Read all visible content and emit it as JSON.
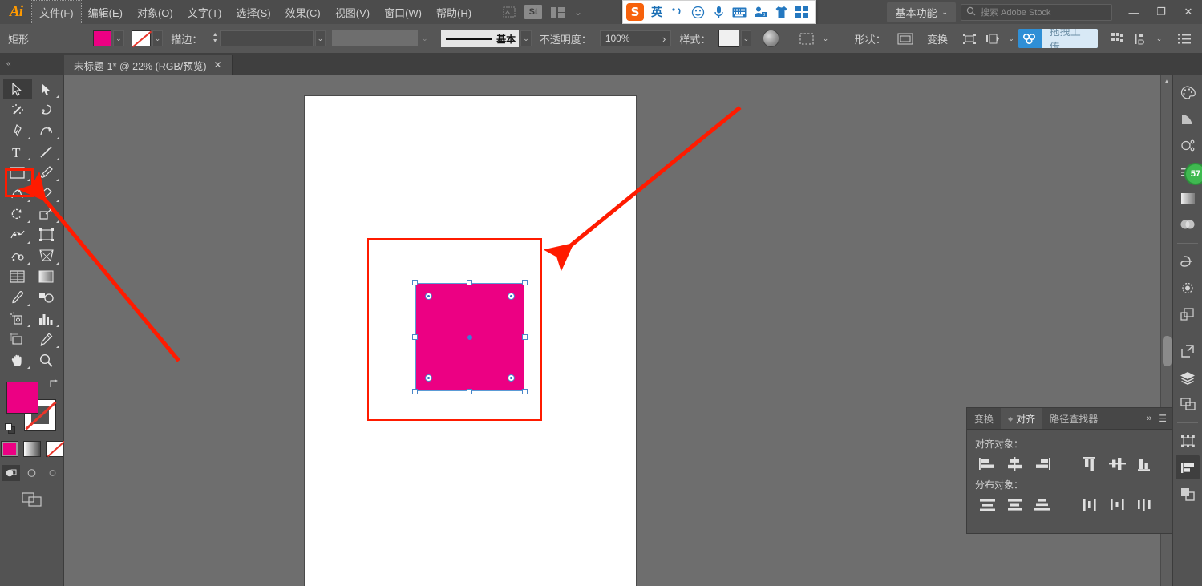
{
  "app": {
    "name": "Ai",
    "logo_color": "#ff9a00"
  },
  "menubar": {
    "items": [
      {
        "label": "文件(F)",
        "focused": true
      },
      {
        "label": "编辑(E)",
        "focused": false
      },
      {
        "label": "对象(O)",
        "focused": false
      },
      {
        "label": "文字(T)",
        "focused": false
      },
      {
        "label": "选择(S)",
        "focused": false
      },
      {
        "label": "效果(C)",
        "focused": false
      },
      {
        "label": "视图(V)",
        "focused": false
      },
      {
        "label": "窗口(W)",
        "focused": false
      },
      {
        "label": "帮助(H)",
        "focused": false
      }
    ],
    "bridge_icon": "bridge-icon",
    "stock_icon": "St",
    "arrange_icon": "arrange-documents-icon",
    "workspace": "基本功能",
    "search_placeholder": "搜索 Adobe Stock",
    "search_icon": "search-icon",
    "window_minimize": "—",
    "window_restore": "❐",
    "window_close": "✕"
  },
  "ime": {
    "logo": "S",
    "mode": "英",
    "comma_icon": "punctuation-icon",
    "emoji_icon": "☺",
    "mic_icon": "microphone-icon",
    "keyboard_icon": "keyboard-icon",
    "user_icon": "user-icon",
    "skin_icon": "skin-icon",
    "toolbox_icon": "toolbox-icon"
  },
  "controlbar": {
    "tool_name": "矩形",
    "fill_color": "#ec0083",
    "fill_caret": "⌄",
    "stroke_swatch": "none",
    "stroke_caret": "⌄",
    "stroke_label": "描边：",
    "stroke_weight_value": "",
    "stroke_weight_caret": "⌄",
    "stroke_profile_value": "",
    "stroke_profile_caret": "⌄",
    "brush_def_label": "基本",
    "brush_caret": "⌄",
    "opacity_label": "不透明度：",
    "opacity_value": "100%",
    "opacity_arrow": "›",
    "style_label": "样式：",
    "style_caret": "⌄",
    "recolor_icon": "recolor-artwork-icon",
    "select_similar_icon": "select-similar-icon",
    "select_similar_caret": "⌄",
    "shape_label": "形状：",
    "shape_icon": "shape-icon",
    "transform_label": "变换",
    "align_icon": "align-icon",
    "arrange_icon": "arrange-icon",
    "arrange_caret": "⌄",
    "upload_label": "拖拽上传",
    "upload_icon": "cloud-upload-icon",
    "grid_icon": "grid-icon",
    "distribute_icon": "distribute-icon",
    "distribute_caret": "⌄",
    "menu_icon": "panel-menu-icon"
  },
  "tabbar": {
    "collapse_icon": "«",
    "document_title": "未标题-1* @ 22% (RGB/预览)",
    "close_icon": "✕"
  },
  "toolbar": {
    "rows": [
      [
        {
          "name": "selection-tool",
          "label": "选择工具",
          "selected": true,
          "has_corner": false
        },
        {
          "name": "direct-selection-tool",
          "label": "直接选择工具",
          "selected": false,
          "has_corner": true
        }
      ],
      [
        {
          "name": "magic-wand-tool",
          "label": "魔棒工具",
          "selected": false,
          "has_corner": false
        },
        {
          "name": "lasso-tool",
          "label": "套索工具",
          "selected": false,
          "has_corner": false
        }
      ],
      [
        {
          "name": "pen-tool",
          "label": "钢笔工具",
          "selected": false,
          "has_corner": true
        },
        {
          "name": "curvature-tool",
          "label": "曲率工具",
          "selected": false,
          "has_corner": true
        }
      ],
      [
        {
          "name": "type-tool",
          "label": "文字工具",
          "selected": false,
          "has_corner": true
        },
        {
          "name": "line-segment-tool",
          "label": "直线段工具",
          "selected": false,
          "has_corner": true
        }
      ],
      [
        {
          "name": "rectangle-tool",
          "label": "矩形工具",
          "selected": false,
          "has_corner": true
        },
        {
          "name": "paintbrush-tool",
          "label": "画笔工具",
          "selected": false,
          "has_corner": true
        }
      ],
      [
        {
          "name": "shaper-tool",
          "label": "Shaper 工具",
          "selected": false,
          "has_corner": true
        },
        {
          "name": "eraser-tool",
          "label": "橡皮擦工具",
          "selected": false,
          "has_corner": true
        }
      ],
      [
        {
          "name": "rotate-tool",
          "label": "旋转工具",
          "selected": false,
          "has_corner": true
        },
        {
          "name": "scale-tool",
          "label": "比例缩放工具",
          "selected": false,
          "has_corner": true
        }
      ],
      [
        {
          "name": "width-tool",
          "label": "宽度工具",
          "selected": false,
          "has_corner": true
        },
        {
          "name": "free-transform-tool",
          "label": "自由变换工具",
          "selected": false,
          "has_corner": false
        }
      ],
      [
        {
          "name": "shape-builder-tool",
          "label": "形状生成器工具",
          "selected": false,
          "has_corner": true
        },
        {
          "name": "perspective-grid-tool",
          "label": "透视网格工具",
          "selected": false,
          "has_corner": true
        }
      ],
      [
        {
          "name": "mesh-tool",
          "label": "网格工具",
          "selected": false,
          "has_corner": false
        },
        {
          "name": "gradient-tool",
          "label": "渐变工具",
          "selected": false,
          "has_corner": false
        }
      ],
      [
        {
          "name": "eyedropper-tool",
          "label": "吸管工具",
          "selected": false,
          "has_corner": true
        },
        {
          "name": "blend-tool",
          "label": "混合工具",
          "selected": false,
          "has_corner": false
        }
      ],
      [
        {
          "name": "symbol-sprayer-tool",
          "label": "符号喷枪工具",
          "selected": false,
          "has_corner": true
        },
        {
          "name": "column-graph-tool",
          "label": "柱形图工具",
          "selected": false,
          "has_corner": true
        }
      ],
      [
        {
          "name": "artboard-tool",
          "label": "画板工具",
          "selected": false,
          "has_corner": false
        },
        {
          "name": "slice-tool",
          "label": "切片工具",
          "selected": false,
          "has_corner": true
        }
      ],
      [
        {
          "name": "hand-tool",
          "label": "抓手工具",
          "selected": false,
          "has_corner": true
        },
        {
          "name": "zoom-tool",
          "label": "缩放工具",
          "selected": false,
          "has_corner": false
        }
      ]
    ],
    "fill_color": "#ec0083",
    "stroke_color": "none",
    "swap_icon": "swap-fill-stroke-icon",
    "default_icon": "default-fill-stroke-icon",
    "modes": [
      {
        "name": "color-mode",
        "label": "颜色",
        "active": true
      },
      {
        "name": "gradient-mode",
        "label": "渐变",
        "active": false
      },
      {
        "name": "none-mode",
        "label": "无",
        "active": false
      }
    ],
    "draw_modes": [
      {
        "name": "draw-normal-mode",
        "label": "正常绘图",
        "active": true
      },
      {
        "name": "draw-behind-mode",
        "label": "背面绘图",
        "active": false
      },
      {
        "name": "draw-inside-mode",
        "label": "内部绘图",
        "active": false
      }
    ],
    "screen_mode": "change-screen-mode-icon"
  },
  "canvas": {
    "background": "#6e6e6e",
    "artboard_color": "#ffffff",
    "shape": {
      "name": "rectangle",
      "fill": "#ec0083",
      "selection_color": "#5b9bd5"
    },
    "annotation_color": "#ff1b00",
    "scrollbar": {
      "up_arrow": "▲"
    }
  },
  "right_dock": {
    "icons": [
      {
        "name": "color-panel-icon",
        "label": "颜色",
        "badge": null,
        "active": false
      },
      {
        "name": "color-guide-panel-icon",
        "label": "颜色参考",
        "badge": null,
        "active": false
      },
      {
        "name": "symbols-panel-icon",
        "label": "符号",
        "badge": null,
        "active": false
      },
      {
        "name": "stroke-panel-icon",
        "label": "描边",
        "badge": "57",
        "active": false
      },
      {
        "name": "gradient-panel-icon",
        "label": "渐变",
        "badge": null,
        "active": false
      },
      {
        "name": "transparency-panel-icon",
        "label": "透明度",
        "badge": null,
        "active": false
      },
      {
        "name": "creative-cloud-libraries-icon",
        "label": "CC 库",
        "badge": null,
        "active": false
      },
      {
        "name": "brushes-panel-icon",
        "label": "画笔",
        "badge": null,
        "active": false
      },
      {
        "name": "appearance-panel-icon",
        "label": "外观",
        "badge": null,
        "active": false
      },
      {
        "name": "asset-export-panel-icon",
        "label": "资源导出",
        "badge": null,
        "active": false
      },
      {
        "name": "layers-panel-icon",
        "label": "图层",
        "badge": null,
        "active": false
      },
      {
        "name": "artboards-panel-icon",
        "label": "画板",
        "badge": null,
        "active": false
      },
      {
        "name": "transform-panel-icon",
        "label": "变换",
        "badge": null,
        "active": false
      },
      {
        "name": "align-panel-icon",
        "label": "对齐",
        "badge": null,
        "active": true
      },
      {
        "name": "pathfinder-panel-icon",
        "label": "路径查找器",
        "badge": null,
        "active": false
      }
    ]
  },
  "align_panel": {
    "tabs": [
      {
        "label": "变换",
        "active": false
      },
      {
        "label": "对齐",
        "active": true
      },
      {
        "label": "路径查找器",
        "active": false
      }
    ],
    "collapse_icon": "»",
    "menu_icon": "☰",
    "align_section": "对齐对象：",
    "align_buttons": [
      {
        "name": "align-left-icon",
        "label": "水平左对齐"
      },
      {
        "name": "align-horizontal-center-icon",
        "label": "水平居中对齐"
      },
      {
        "name": "align-right-icon",
        "label": "水平右对齐"
      },
      {
        "name": "align-top-icon",
        "label": "垂直顶对齐"
      },
      {
        "name": "align-vertical-center-icon",
        "label": "垂直居中对齐"
      },
      {
        "name": "align-bottom-icon",
        "label": "垂直底对齐"
      }
    ],
    "distribute_section": "分布对象：",
    "distribute_buttons": [
      {
        "name": "distribute-top-icon",
        "label": "垂直顶分布"
      },
      {
        "name": "distribute-vertical-center-icon",
        "label": "垂直居中分布"
      },
      {
        "name": "distribute-bottom-icon",
        "label": "垂直底分布"
      },
      {
        "name": "distribute-left-icon",
        "label": "水平左分布"
      },
      {
        "name": "distribute-horizontal-center-icon",
        "label": "水平居中分布"
      },
      {
        "name": "distribute-right-icon",
        "label": "水平右分布"
      }
    ]
  }
}
